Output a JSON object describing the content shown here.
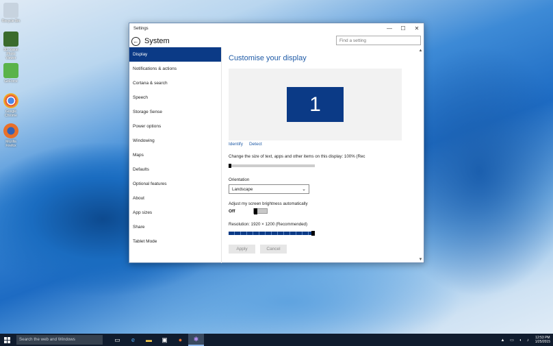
{
  "desktop": {
    "icons": [
      {
        "label": "Recycle Bin",
        "color": "#c7d3df"
      },
      {
        "label": "3D Vision Photo Viewer",
        "color": "#3a6b2c"
      },
      {
        "label": "GeForce",
        "color": "#5ab34a"
      },
      {
        "label": "Google Chrome",
        "color": "#e0453a"
      },
      {
        "label": "Mozilla Firefox",
        "color": "#e8702a"
      }
    ]
  },
  "window": {
    "title": "Settings",
    "minimize_glyph": "—",
    "maximize_glyph": "☐",
    "close_glyph": "✕",
    "back_glyph": "←",
    "section_title": "System",
    "search_placeholder": "Find a setting"
  },
  "sidebar": {
    "items": [
      {
        "label": "Display",
        "active": true
      },
      {
        "label": "Notifications & actions"
      },
      {
        "label": "Cortana & search"
      },
      {
        "label": "Speech"
      },
      {
        "label": "Storage Sense"
      },
      {
        "label": "Power options"
      },
      {
        "label": "Windowing"
      },
      {
        "label": "Maps"
      },
      {
        "label": "Defaults"
      },
      {
        "label": "Optional features"
      },
      {
        "label": "About"
      },
      {
        "label": "App sizes"
      },
      {
        "label": "Share"
      },
      {
        "label": "Tablet Mode"
      }
    ]
  },
  "display": {
    "title": "Customise your display",
    "monitor_number": "1",
    "identify_link": "Identify",
    "detect_link": "Detect",
    "scale_text": "Change the size of text, apps and other items on this display: 100% (Rec",
    "scale_value": 0,
    "orientation_label": "Orientation",
    "orientation_value": "Landscape",
    "brightness_label": "Adjust my screen brightness automatically",
    "brightness_state": "Off",
    "resolution_label": "Resolution: 1920 × 1200 (Recommended)",
    "resolution_value": 1.0,
    "apply_label": "Apply",
    "cancel_label": "Cancel"
  },
  "taskbar": {
    "search_placeholder": "Search the web and Windows",
    "time": "12:53 PM",
    "date": "1/25/2015",
    "accent": "#101c2e"
  }
}
